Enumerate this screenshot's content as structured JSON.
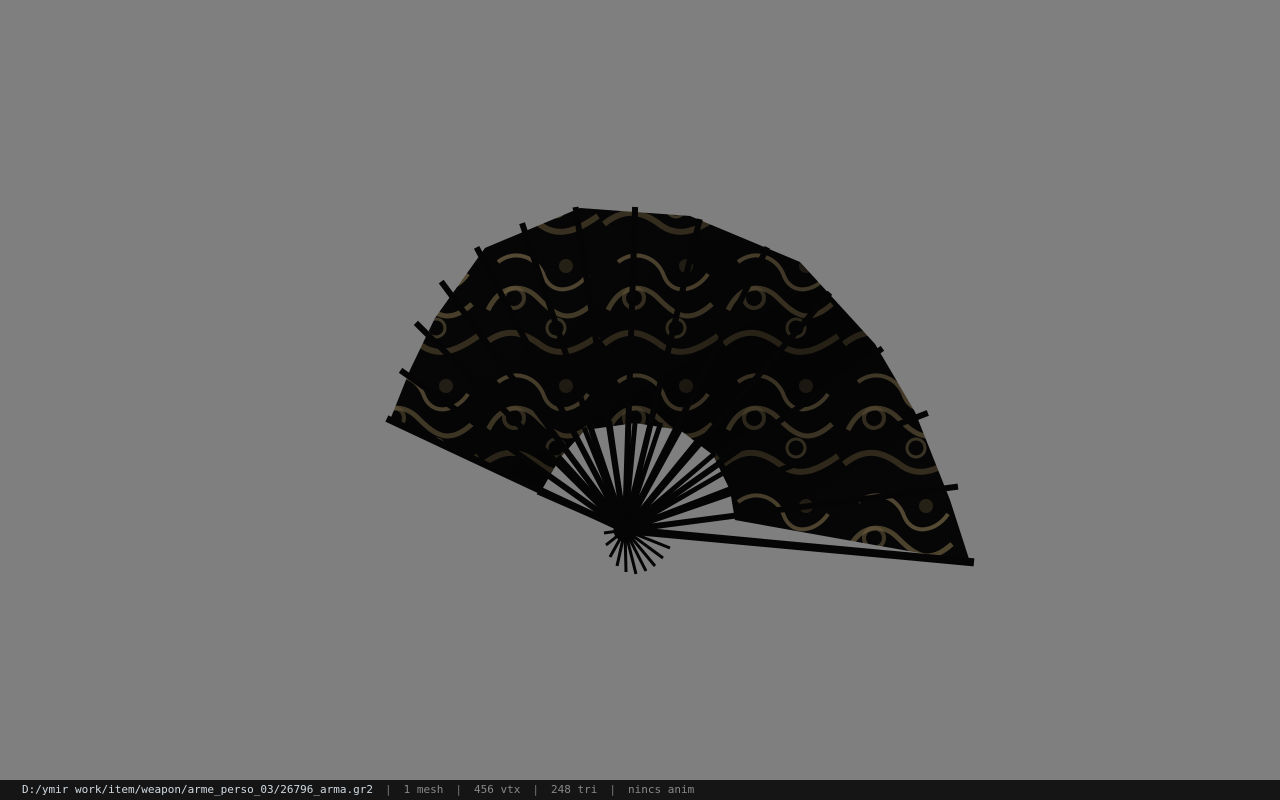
{
  "viewer": {
    "background_color": "#7f7f7f",
    "model": {
      "icon": "folding-fan-icon",
      "leaf_color": "#0b0b0b",
      "pattern_color": "#8d7a52",
      "rib_color": "#050505"
    }
  },
  "status_bar": {
    "path": "D:/ymir work/item/weapon/arme_perso_03/26796_arma.gr2",
    "separator": "|",
    "mesh_count": "1 mesh",
    "vertex_count": "456 vtx",
    "triangle_count": "248 tri",
    "animation": "nincs anim"
  }
}
